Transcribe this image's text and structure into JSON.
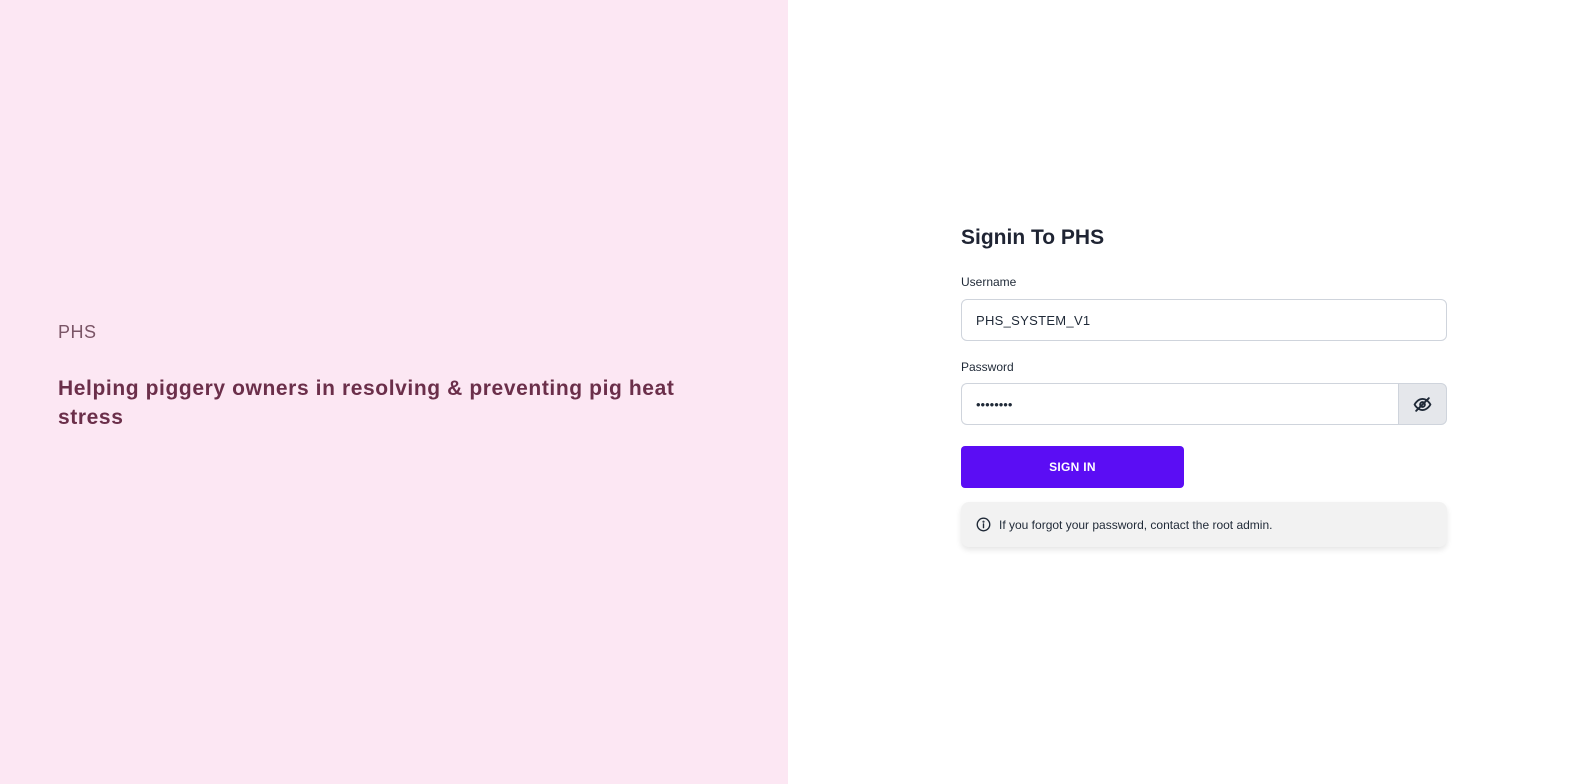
{
  "left": {
    "brand": "PHS",
    "tagline": "Helping piggery owners in resolving & preventing pig heat stress"
  },
  "form": {
    "title": "Signin To PHS",
    "username_label": "Username",
    "username_value": "PHS_SYSTEM_V1",
    "password_label": "Password",
    "password_value": "••••••••",
    "toggle_icon": "eye-slash-icon",
    "signin_label": "SIGN IN",
    "info_icon": "info-circle-icon",
    "info_text": "If you forgot your password, contact the root admin."
  },
  "colors": {
    "left_background": "#fce7f3",
    "brand_text": "#7a5566",
    "tagline_text": "#6b2f4a",
    "primary": "#5b0df4",
    "info_background": "#f2f2f2"
  }
}
